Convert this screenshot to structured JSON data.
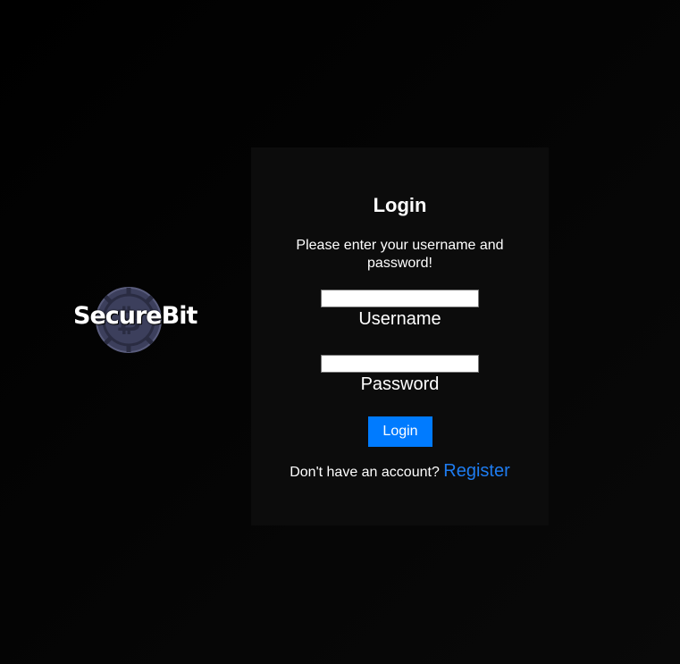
{
  "brand": {
    "name": "SecureBit",
    "icon": "bitcoin-coin-icon",
    "coin_color": "#3c3f5c"
  },
  "login": {
    "title": "Login",
    "subtitle": "Please enter your username and password!",
    "username_label": "Username",
    "username_value": "",
    "password_label": "Password",
    "password_value": "",
    "button_label": "Login",
    "register_prompt": "Don't have an account?",
    "register_link": "Register"
  },
  "colors": {
    "background": "#050505",
    "panel": "#0c0c0c",
    "accent": "#007bff",
    "link": "#1e7cf0"
  }
}
